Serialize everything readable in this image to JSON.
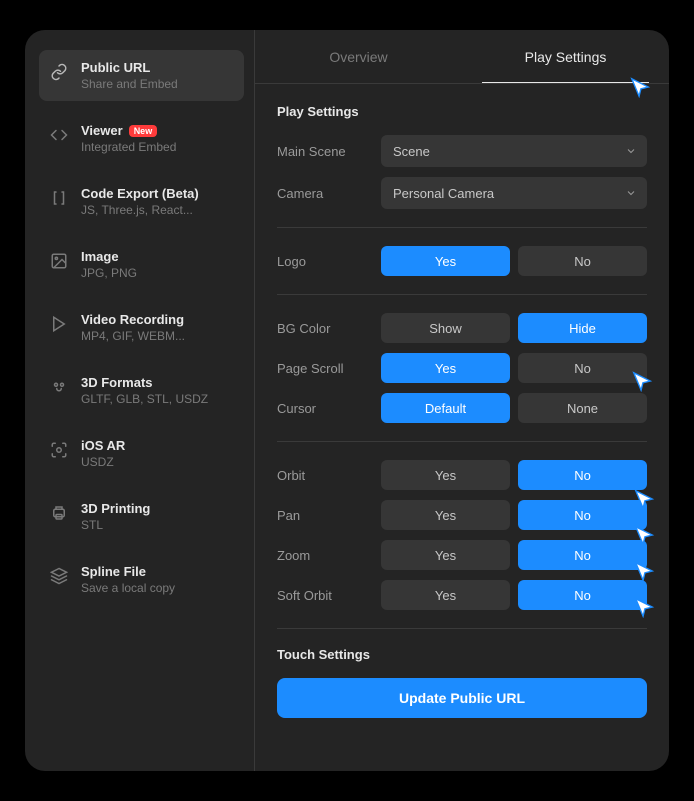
{
  "sidebar": {
    "items": [
      {
        "title": "Public URL",
        "sub": "Share and Embed",
        "badge": null
      },
      {
        "title": "Viewer",
        "sub": "Integrated Embed",
        "badge": "New"
      },
      {
        "title": "Code Export (Beta)",
        "sub": "JS, Three.js, React...",
        "badge": null
      },
      {
        "title": "Image",
        "sub": "JPG, PNG",
        "badge": null
      },
      {
        "title": "Video Recording",
        "sub": "MP4, GIF, WEBM...",
        "badge": null
      },
      {
        "title": "3D Formats",
        "sub": "GLTF, GLB, STL, USDZ",
        "badge": null
      },
      {
        "title": "iOS AR",
        "sub": "USDZ",
        "badge": null
      },
      {
        "title": "3D Printing",
        "sub": "STL",
        "badge": null
      },
      {
        "title": "Spline File",
        "sub": "Save a local copy",
        "badge": null
      }
    ]
  },
  "tabs": {
    "overview": "Overview",
    "play_settings": "Play Settings"
  },
  "sections": {
    "play_settings_title": "Play Settings",
    "touch_settings_title": "Touch Settings"
  },
  "rows": {
    "main_scene": {
      "label": "Main Scene",
      "value": "Scene"
    },
    "camera": {
      "label": "Camera",
      "value": "Personal Camera"
    },
    "logo": {
      "label": "Logo",
      "opt1": "Yes",
      "opt2": "No"
    },
    "bg_color": {
      "label": "BG Color",
      "opt1": "Show",
      "opt2": "Hide"
    },
    "page_scroll": {
      "label": "Page Scroll",
      "opt1": "Yes",
      "opt2": "No"
    },
    "cursor": {
      "label": "Cursor",
      "opt1": "Default",
      "opt2": "None"
    },
    "orbit": {
      "label": "Orbit",
      "opt1": "Yes",
      "opt2": "No"
    },
    "pan": {
      "label": "Pan",
      "opt1": "Yes",
      "opt2": "No"
    },
    "zoom": {
      "label": "Zoom",
      "opt1": "Yes",
      "opt2": "No"
    },
    "soft_orbit": {
      "label": "Soft Orbit",
      "opt1": "Yes",
      "opt2": "No"
    }
  },
  "update_button": "Update Public URL"
}
